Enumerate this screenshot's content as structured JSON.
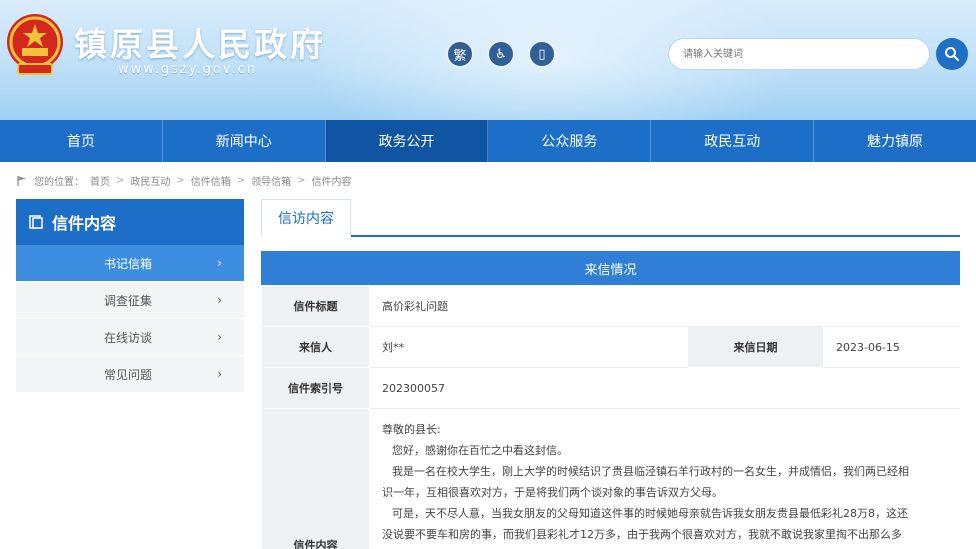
{
  "header": {
    "site_title": "镇原县人民政府",
    "site_url": "www.gszy.gov.cn",
    "tools": [
      {
        "label": "繁",
        "icon": "traditional-chinese-icon"
      },
      {
        "label": "♿",
        "icon": "accessibility-icon"
      },
      {
        "label": "▯",
        "icon": "mobile-icon"
      }
    ],
    "search_placeholder": "请输入关键词",
    "emblem_icon": "national-emblem-icon",
    "search_icon": "search-icon"
  },
  "nav": {
    "items": [
      "首页",
      "新闻中心",
      "政务公开",
      "公众服务",
      "政民互动",
      "魅力镇原"
    ]
  },
  "breadcrumb": {
    "prefix": "您的位置：",
    "items": [
      "首页",
      "政民互动",
      "信件信箱",
      "领导信箱",
      "信件内容"
    ]
  },
  "sidebar": {
    "title": "信件内容",
    "items": [
      "书记信箱",
      "调查征集",
      "在线访谈",
      "常见问题"
    ]
  },
  "main": {
    "tab": "信访内容",
    "section_title": "来信情况",
    "labels": {
      "subject": "信件标题",
      "sender": "来信人",
      "date": "来信日期",
      "index": "信件索引号",
      "content": "信件内容"
    },
    "values": {
      "subject": "高价彩礼问题",
      "sender": "刘**",
      "date": "2023-06-15",
      "index": "202300057"
    },
    "content_lines": [
      "尊敬的县长:",
      "您好，感谢你在百忙之中看这封信。",
      "我是一名在校大学生，刚上大学的时候结识了贵县临泾镇石羊行政村的一名女生，并成情侣，我们两已经相",
      "识一年，互相很喜欢对方，于是将我们两个谈对象的事告诉双方父母。",
      "可是，天不尽人意，当我女朋友的父母知道这件事的时候她母亲就告诉我女朋友贵县最低彩礼28万8，这还",
      "没说要不要车和房的事，而我们县彩礼才12万多，由于我两个很喜欢对方，我就不敢说我家里掏不出那么多"
    ]
  }
}
